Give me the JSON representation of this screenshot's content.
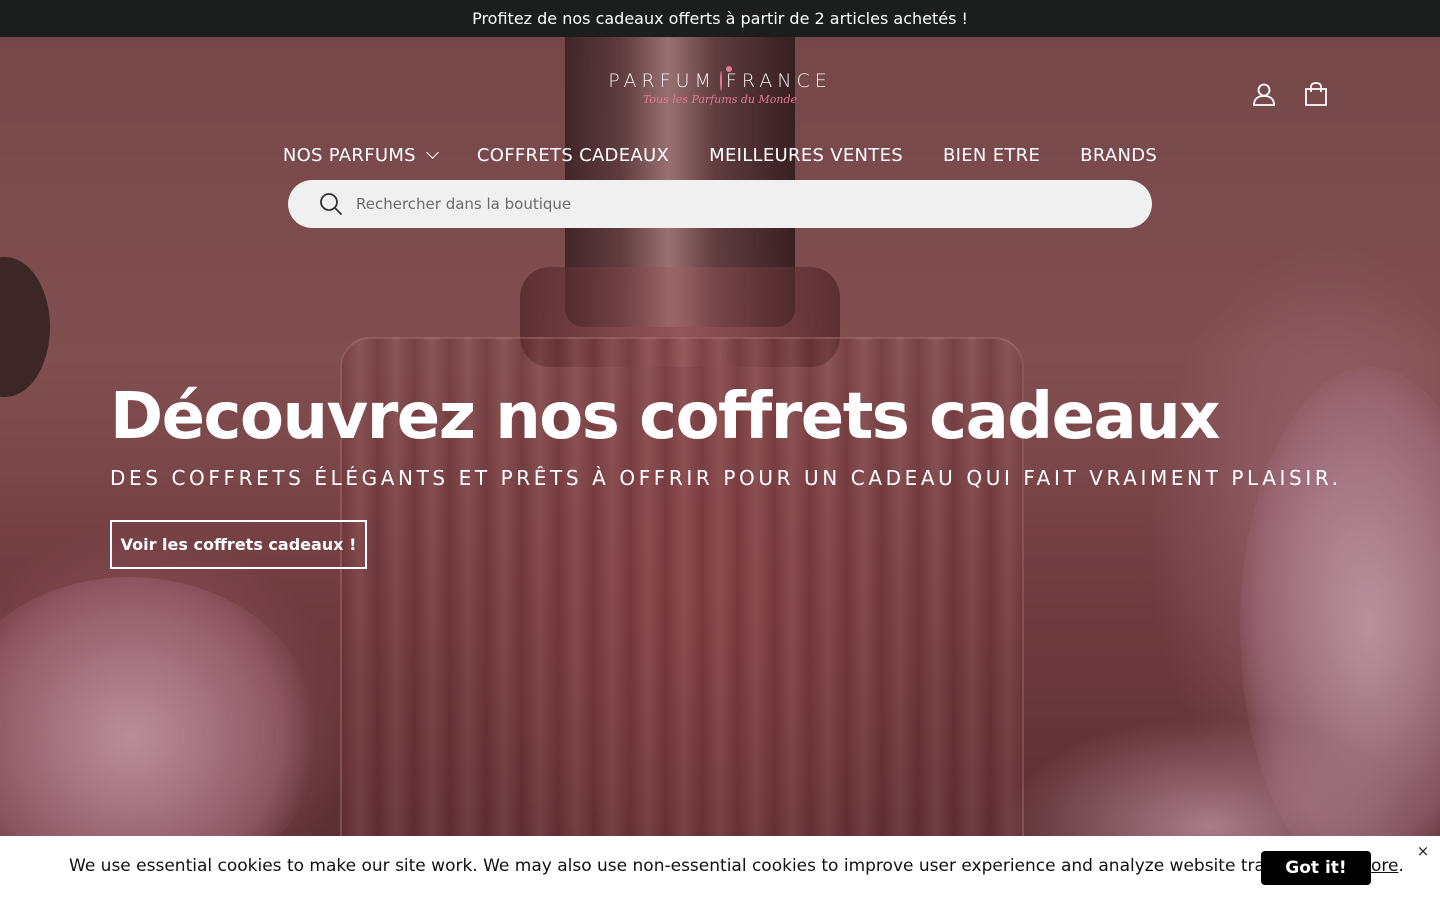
{
  "announcement": {
    "text": "Profitez de nos cadeaux offerts à partir de 2 articles achetés !"
  },
  "header": {
    "logo_main_left": "PARFUM",
    "logo_main_right": "FRANCE",
    "logo_tagline": "Tous les Parfums du Monde",
    "account_icon": "user-icon",
    "cart_icon": "shopping-bag-icon"
  },
  "nav": {
    "items": [
      {
        "label": "NOS PARFUMS",
        "has_dropdown": true
      },
      {
        "label": "COFFRETS CADEAUX"
      },
      {
        "label": "MEILLEURES VENTES"
      },
      {
        "label": "BIEN ETRE"
      },
      {
        "label": "BRANDS"
      }
    ]
  },
  "search": {
    "placeholder": "Rechercher dans la boutique",
    "value": ""
  },
  "hero": {
    "title": "Découvrez nos coffrets cadeaux",
    "subtitle": "DES COFFRETS ÉLÉGANTS ET PRÊTS À OFFRIR POUR UN CADEAU QUI FAIT VRAIMENT PLAISIR.",
    "cta_label": "Voir les coffrets cadeaux !"
  },
  "cookie": {
    "text": "We use essential cookies to make our site work. We may also use non-essential cookies to improve user experience and analyze website traffic.",
    "link_label": "Learn more",
    "suffix": ".",
    "accept_label": "Got it!",
    "close_label": "×"
  },
  "colors": {
    "announcement_bg": "#1c1d1d",
    "logo_accent": "#e4799a",
    "search_bg": "#f1f0f0",
    "cookie_button_bg": "#000000"
  }
}
